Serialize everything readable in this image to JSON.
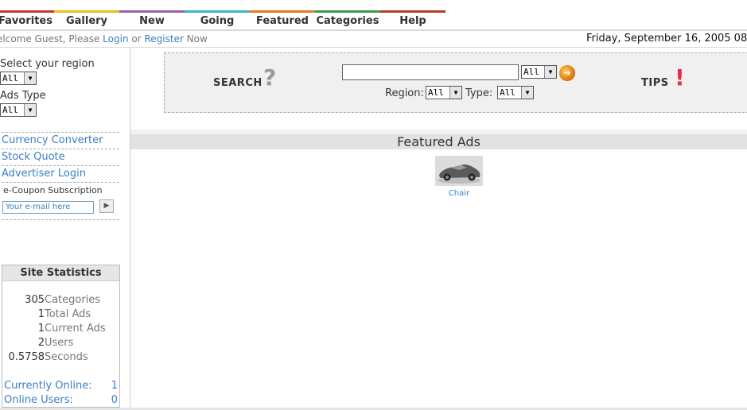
{
  "nav": {
    "items": [
      {
        "label": "Favorites",
        "color": "#cc3333"
      },
      {
        "label": "Gallery",
        "color": "#e8c020"
      },
      {
        "label": "New",
        "color": "#9a5fb0"
      },
      {
        "label": "Going",
        "color": "#3bb8c0"
      },
      {
        "label": "Featured",
        "color": "#e87a20"
      },
      {
        "label": "Categories",
        "color": "#3a9a50"
      },
      {
        "label": "Help",
        "color": "#b04020"
      }
    ]
  },
  "welcome": {
    "prefix": "elcome Guest, Please ",
    "login": "Login",
    "or": " or ",
    "register": "Register",
    "suffix": " Now",
    "datetime": "Friday, September 16, 2005 08"
  },
  "sidebar": {
    "region_label": "Select your region",
    "region_value": "All",
    "ads_type_label": "Ads Type",
    "ads_type_value": "All",
    "links": [
      "Currency Converter",
      "Stock Quote",
      "Advertiser Login"
    ],
    "coupon_label": "e-Coupon Subscription",
    "coupon_placeholder": "Your e-mail here"
  },
  "stats": {
    "title": "Site Statistics",
    "rows": [
      {
        "value": "305",
        "label": "Categories"
      },
      {
        "value": "1",
        "label": "Total Ads"
      },
      {
        "value": "1",
        "label": "Current Ads"
      },
      {
        "value": "2",
        "label": "Users"
      },
      {
        "value": "0.5758",
        "label": "Seconds"
      }
    ],
    "online": [
      {
        "label": "Currently Online:",
        "value": "1"
      },
      {
        "label": "Online Users:",
        "value": "0"
      }
    ]
  },
  "search": {
    "label": "SEARCH",
    "category_value": "All",
    "region_label": "Region:",
    "region_value": "All",
    "type_label": "Type:",
    "type_value": "All",
    "tips_label": "TIPS"
  },
  "featured": {
    "title": "Featured Ads",
    "item_caption": "Chair"
  }
}
